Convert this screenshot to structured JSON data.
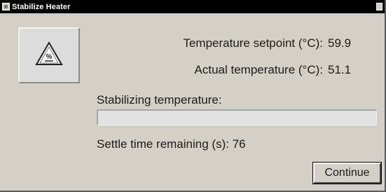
{
  "window": {
    "title": "Stabilize Heater"
  },
  "icons": {
    "title_icon": "window-app-icon",
    "warning_icon": "hot-surface-warning-icon",
    "warning_icon_text": "%"
  },
  "readouts": {
    "setpoint_label": "Temperature setpoint (°C):",
    "setpoint_value": "59.9",
    "actual_label": "Actual temperature (°C):",
    "actual_value": "51.1"
  },
  "status": {
    "stabilizing_label": "Stabilizing temperature:",
    "progress_fraction": 0,
    "settle_label": "Settle time remaining (s):",
    "settle_value": "76"
  },
  "actions": {
    "continue_label": "Continue"
  }
}
